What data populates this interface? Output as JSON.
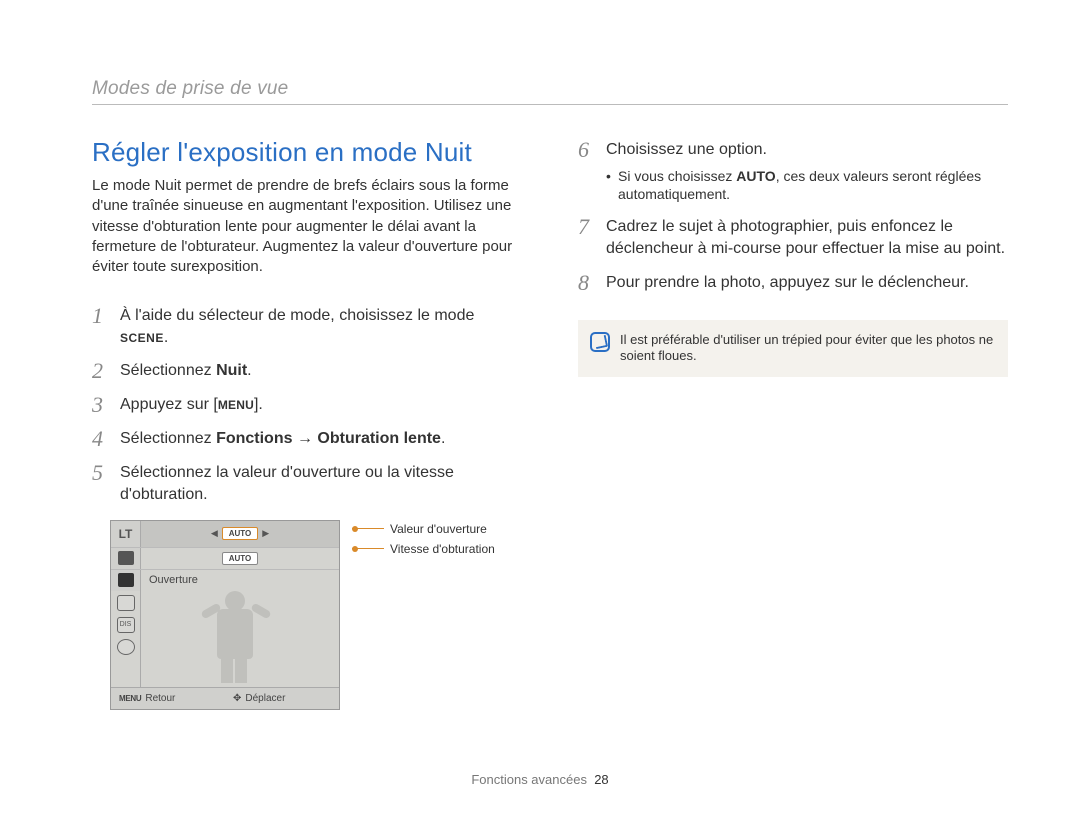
{
  "header": {
    "breadcrumb": "Modes de prise de vue"
  },
  "left": {
    "title": "Régler l'exposition en mode Nuit",
    "intro": "Le mode Nuit permet de prendre de brefs éclairs sous la forme d'une traînée sinueuse en augmentant l'exposition. Utilisez une vitesse d'obturation lente pour augmenter le délai avant la fermeture de l'obturateur. Augmentez la valeur d'ouverture pour éviter toute surexposition.",
    "steps": {
      "s1_a": "À l'aide du sélecteur de mode, choisissez le mode ",
      "s1_scene": "SCENE",
      "s1_b": ".",
      "s2_a": "Sélectionnez ",
      "s2_bold": "Nuit",
      "s2_b": ".",
      "s3_a": "Appuyez sur [",
      "s3_menu": "MENU",
      "s3_b": "].",
      "s4_a": "Sélectionnez ",
      "s4_bold": "Fonctions → Obturation lente",
      "s4_b": ".",
      "s5": "Sélectionnez la valeur d'ouverture ou la vitesse d'obturation."
    },
    "figure": {
      "lt": "LT",
      "auto_top": "AUTO",
      "auto_row2": "AUTO",
      "ouverture": "Ouverture",
      "retour": "Retour",
      "deplacer": "Déplacer",
      "menu": "MENU",
      "anno1": "Valeur d'ouverture",
      "anno2": "Vitesse d'obturation"
    }
  },
  "right": {
    "steps": {
      "s6": "Choisissez une option.",
      "s6_sub_a": "Si vous choisissez ",
      "s6_sub_bold": "AUTO",
      "s6_sub_b": ", ces deux valeurs seront réglées automatiquement.",
      "s7": "Cadrez le sujet à photographier, puis enfoncez le déclencheur à mi-course pour effectuer la mise au point.",
      "s8": "Pour prendre la photo, appuyez sur le déclencheur."
    },
    "note": "Il est préférable d'utiliser un trépied pour éviter que les photos ne soient floues."
  },
  "footer": {
    "section": "Fonctions avancées",
    "page": "28"
  }
}
